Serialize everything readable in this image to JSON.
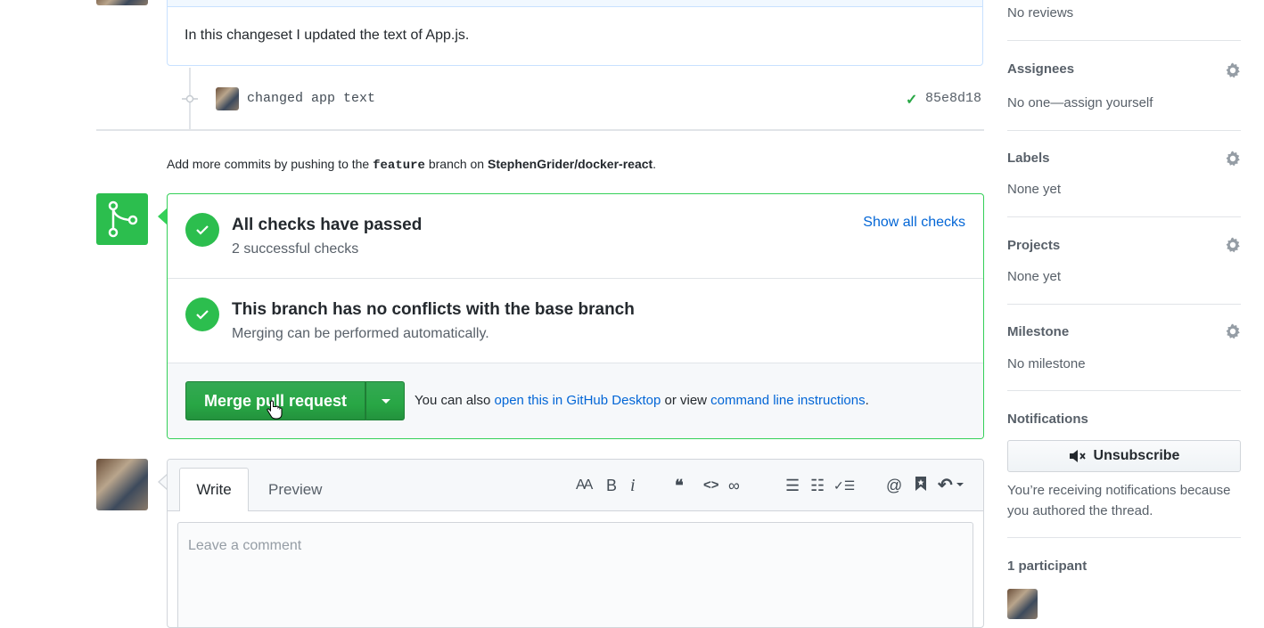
{
  "timeline": {
    "description_text": "In this changeset I updated the text of App.js.",
    "commit": {
      "message": "changed app text",
      "check": "✓",
      "sha": "85e8d18"
    },
    "push_hint": {
      "prefix": "Add more commits by pushing to the",
      "branch": "feature",
      "middle": "branch on",
      "repo": "StephenGrider/docker-react",
      "suffix": "."
    }
  },
  "merge": {
    "checks_title": "All checks have passed",
    "checks_sub": "2 successful checks",
    "show_all_checks": "Show all checks",
    "conflicts_title": "This branch has no conflicts with the base branch",
    "conflicts_sub": "Merging can be performed automatically.",
    "merge_button": "Merge pull request",
    "help_prefix": "You can also",
    "help_link1": "open this in GitHub Desktop",
    "help_middle": "or view",
    "help_link2": "command line instructions",
    "help_suffix": ".",
    "colors": {
      "success": "#2cbe4e",
      "border": "#34d058",
      "link": "#0366d6"
    }
  },
  "composer": {
    "tab_write": "Write",
    "tab_preview": "Preview",
    "placeholder": "Leave a comment",
    "toolbar": {
      "heading": "AA",
      "bold": "B",
      "italic": "i",
      "quote": "❝",
      "code": "<>",
      "link": "∞",
      "bullets": "☰",
      "numbered": "☷",
      "tasks": "✓☰",
      "mention": "@",
      "saved": "🔖",
      "reply": "↶"
    }
  },
  "sidebar": {
    "reviewers_text": "No reviews",
    "assignees_title": "Assignees",
    "assignees_text": "No one—assign yourself",
    "labels_title": "Labels",
    "labels_text": "None yet",
    "projects_title": "Projects",
    "projects_text": "None yet",
    "milestone_title": "Milestone",
    "milestone_text": "No milestone",
    "notifications_title": "Notifications",
    "unsubscribe_label": "Unsubscribe",
    "notifications_text": "You’re receiving notifications because you authored the thread.",
    "participants_title": "1 participant"
  }
}
